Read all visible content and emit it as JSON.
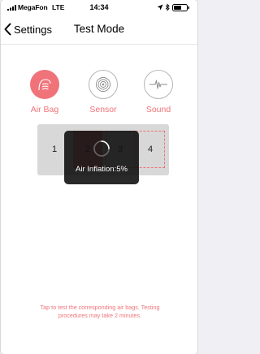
{
  "status_bar": {
    "carrier": "MegaFon",
    "network": "LTE",
    "time": "14:34"
  },
  "nav": {
    "back_label": "Settings",
    "title": "Test Mode"
  },
  "modes": [
    {
      "label": "Air Bag",
      "icon": "air-bag-icon",
      "active": true
    },
    {
      "label": "Sensor",
      "icon": "sensor-icon",
      "active": false
    },
    {
      "label": "Sound",
      "icon": "sound-wave-icon",
      "active": false
    }
  ],
  "bags": [
    "1",
    "2",
    "3",
    "4"
  ],
  "toast": {
    "text": "Air Inflation:5%",
    "progress_percent": 5
  },
  "hint": "Tap to test the corresponding air bags. Testing procedures may take 2 minutes.",
  "colors": {
    "accent": "#ef7379",
    "panel": "#d8d8d8",
    "toast_bg": "#121212"
  }
}
